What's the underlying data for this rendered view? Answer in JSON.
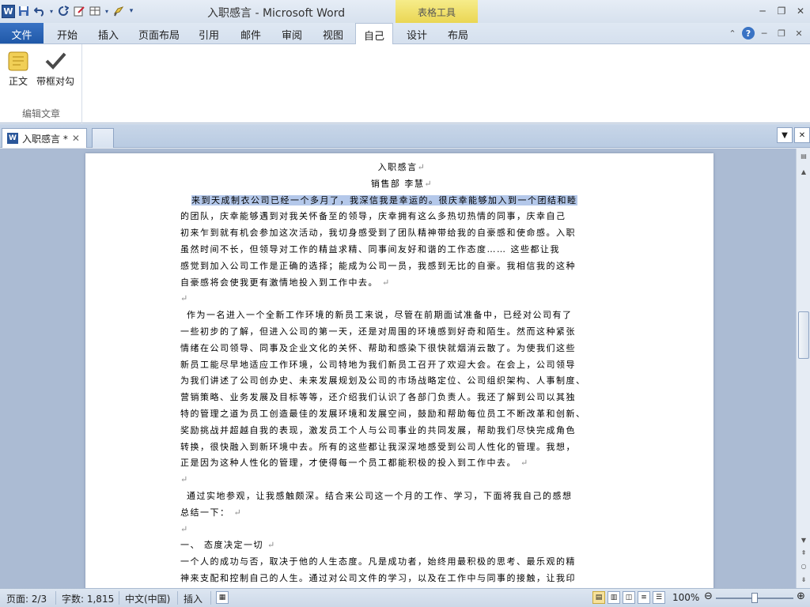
{
  "window": {
    "title": "入职感言 - Microsoft Word",
    "context_tab_header": "表格工具"
  },
  "qat": {
    "logo": "W",
    "save_icon": "save-icon",
    "undo_icon": "undo-icon",
    "redo_icon": "redo-icon"
  },
  "tabs": [
    {
      "label": "文件"
    },
    {
      "label": "开始"
    },
    {
      "label": "插入"
    },
    {
      "label": "页面布局"
    },
    {
      "label": "引用"
    },
    {
      "label": "邮件"
    },
    {
      "label": "审阅"
    },
    {
      "label": "视图"
    },
    {
      "label": "自己"
    },
    {
      "label": "设计"
    },
    {
      "label": "布局"
    }
  ],
  "ribbon": {
    "btn_zhengwen": "正文",
    "btn_daikuang": "带框对勾",
    "group_label": "编辑文章"
  },
  "doctab": {
    "name": "入职感言 *"
  },
  "document": {
    "title": "入职感言",
    "author": "销售部   李慧",
    "lines": [
      "来到天成制衣公司已经一个多月了，我深信我是幸运的。很庆幸能够加入到一个团结和睦",
      "的团队，庆幸能够遇到对我关怀备至的领导，庆幸拥有这么多热切热情的同事，庆幸自己",
      "初来乍到就有机会参加这次活动，我切身感受到了团队精神带给我的自豪感和使命感。入职",
      "虽然时间不长，但领导对工作的精益求精、同事间友好和谐的工作态度……   这些都让我",
      "感觉到加入公司工作是正确的选择；能成为公司一员，我感到无比的自豪。我相信我的这种",
      "自豪感将会使我更有激情地投入到工作中去。",
      "",
      "作为一名进入一个全新工作环境的新员工来说，尽管在前期面试准备中，已经对公司有了",
      "一些初步的了解，但进入公司的第一天，还是对周围的环境感到好奇和陌生。然而这种紧张",
      "情绪在公司领导、同事及企业文化的关怀、帮助和感染下很快就烟消云散了。为使我们这些",
      "新员工能尽早地适应工作环境，公司特地为我们新员工召开了欢迎大会。在会上，公司领导",
      "为我们讲述了公司创办史、未来发展规划及公司的市场战略定位、公司组织架构、人事制度、",
      "营销策略、业务发展及目标等等，还介绍我们认识了各部门负责人。我还了解到公司以其独",
      "特的管理之道为员工创造最佳的发展环境和发展空间，鼓励和帮助每位员工不断改革和创新、",
      "奖励挑战并超越自我的表现，激发员工个人与公司事业的共同发展，帮助我们尽快完成角色",
      "转换，很快融入到新环境中去。所有的这些都让我深深地感受到公司人性化的管理。我想，",
      "正是因为这种人性化的管理，才使得每一个员工都能积极的投入到工作中去。",
      "",
      "通过实地参观，让我感触颇深。结合来公司这一个月的工作、学习，下面将我自己的感想",
      "总结一下：",
      "",
      "一、    态度决定一切",
      "一个人的成功与否，取决于他的人生态度。凡是成功者，始终用最积极的思考、最乐观的精",
      "神来支配和控制自己的人生。通过对公司文件的学习，以及在工作中与同事的接触，让我印"
    ]
  },
  "status": {
    "page": "页面: 2/3",
    "words": "字数: 1,815",
    "lang": "中文(中国)",
    "insert": "插入",
    "zoom": "100%",
    "zoom_level": 1.0
  }
}
